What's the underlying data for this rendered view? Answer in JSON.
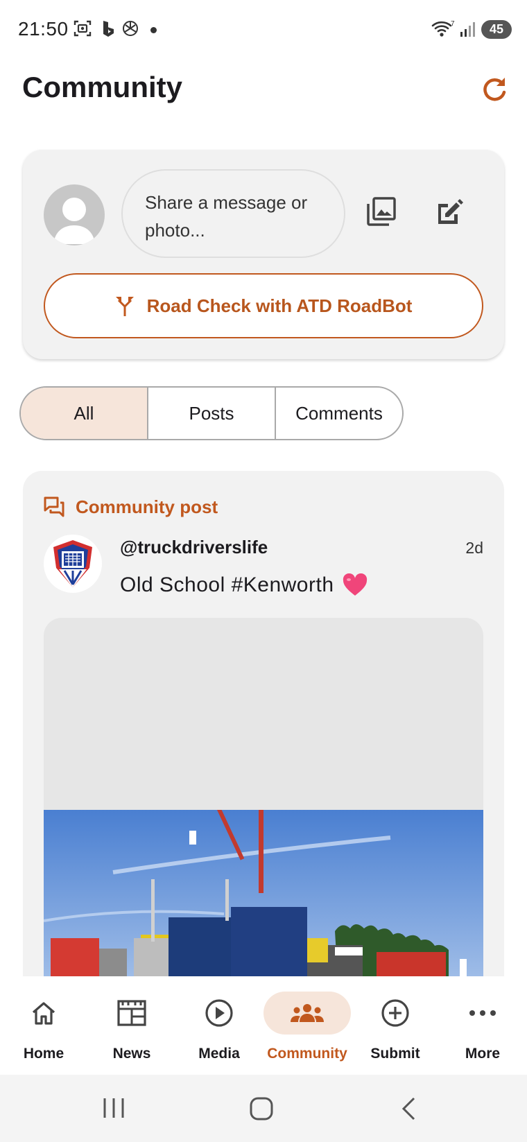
{
  "status_bar": {
    "time": "21:50",
    "battery": "45",
    "icons": [
      "screenshot-icon",
      "bing-icon",
      "chatgpt-icon",
      "notification-dot",
      "wifi-icon",
      "signal-icon",
      "battery-icon"
    ]
  },
  "header": {
    "title": "Community",
    "refresh_icon": "refresh-icon"
  },
  "composer": {
    "placeholder": "Share a message or photo...",
    "photo_icon": "photo-library-icon",
    "edit_icon": "edit-icon",
    "road_check_label": "Road Check with ATD RoadBot",
    "road_check_icon": "fork-route-icon"
  },
  "filters": {
    "items": [
      {
        "label": "All",
        "selected": true
      },
      {
        "label": "Posts",
        "selected": false
      },
      {
        "label": "Comments",
        "selected": false
      }
    ]
  },
  "post": {
    "type_label": "Community post",
    "type_icon": "forum-icon",
    "username": "@truckdriverslife",
    "time_ago": "2d",
    "text": "Old School #Kenworth",
    "emoji": "pink-heart"
  },
  "bottom_nav": {
    "items": [
      {
        "label": "Home",
        "icon": "home-icon",
        "active": false
      },
      {
        "label": "News",
        "icon": "news-icon",
        "active": false
      },
      {
        "label": "Media",
        "icon": "play-circle-icon",
        "active": false
      },
      {
        "label": "Community",
        "icon": "people-icon",
        "active": true
      },
      {
        "label": "Submit",
        "icon": "add-circle-icon",
        "active": false
      },
      {
        "label": "More",
        "icon": "more-horizontal-icon",
        "active": false
      }
    ]
  },
  "colors": {
    "accent": "#c1581e",
    "accent_soft": "#f6e5da",
    "card_bg": "#f2f2f2",
    "heart": "#f0457a"
  }
}
